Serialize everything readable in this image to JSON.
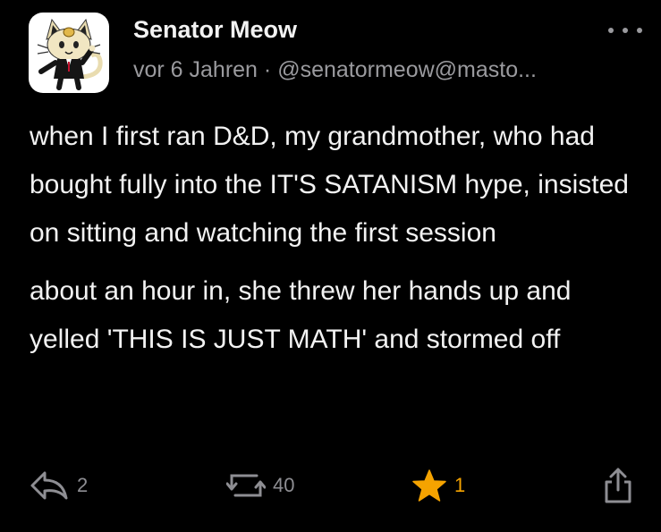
{
  "post": {
    "display_name": "Senator Meow",
    "timestamp": "vor 6 Jahren",
    "separator": "·",
    "handle": "@senatormeow@masto...",
    "paragraphs": [
      "when I first ran D&D, my grandmother, who had bought fully into the IT'S SATANISM hype, insisted on sitting and watching the first session",
      "about an hour in, she threw her hands up and yelled 'THIS IS JUST MATH' and stormed off"
    ]
  },
  "actions": {
    "reply_count": "2",
    "boost_count": "40",
    "favourite_count": "1"
  },
  "icons": {
    "avatar": "cat-avatar-icon",
    "more": "more-options-icon",
    "reply": "reply-icon",
    "boost": "boost-icon",
    "favourite": "star-icon",
    "share": "share-icon"
  },
  "colors": {
    "background": "#000000",
    "text": "#f2f2f2",
    "muted": "#9a9a9e",
    "favourite_accent": "#f5a300"
  }
}
